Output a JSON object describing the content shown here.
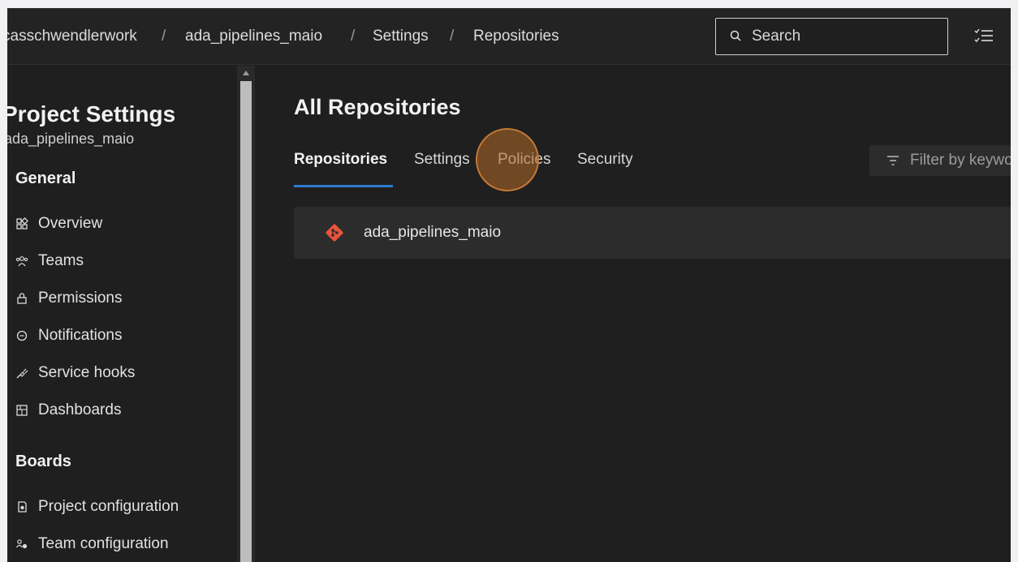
{
  "breadcrumb": {
    "items": [
      "casschwendlerwork",
      "ada_pipelines_maio",
      "Settings",
      "Repositories"
    ],
    "separator": "/"
  },
  "search": {
    "placeholder": "Search"
  },
  "sidebar": {
    "title": "Project Settings",
    "subtitle": "ada_pipelines_maio",
    "sections": [
      {
        "heading": "General",
        "items": [
          {
            "label": "Overview",
            "icon": "overview-icon"
          },
          {
            "label": "Teams",
            "icon": "teams-icon"
          },
          {
            "label": "Permissions",
            "icon": "lock-icon"
          },
          {
            "label": "Notifications",
            "icon": "chat-bubble-icon"
          },
          {
            "label": "Service hooks",
            "icon": "plug-icon"
          },
          {
            "label": "Dashboards",
            "icon": "dashboard-icon"
          }
        ]
      },
      {
        "heading": "Boards",
        "items": [
          {
            "label": "Project configuration",
            "icon": "project-config-icon"
          },
          {
            "label": "Team configuration",
            "icon": "team-config-icon"
          }
        ]
      }
    ]
  },
  "main": {
    "title": "All Repositories",
    "tabs": [
      {
        "label": "Repositories",
        "active": true
      },
      {
        "label": "Settings",
        "active": false
      },
      {
        "label": "Policies",
        "active": false
      },
      {
        "label": "Security",
        "active": false
      }
    ],
    "filter": {
      "placeholder": "Filter by keywords"
    },
    "repositories": [
      {
        "name": "ada_pipelines_maio",
        "icon": "git-icon"
      }
    ]
  },
  "colors": {
    "accent": "#2f7ad1",
    "git": "#e8543a",
    "click_highlight": "#c47a35",
    "background": "#1f1f1f"
  }
}
